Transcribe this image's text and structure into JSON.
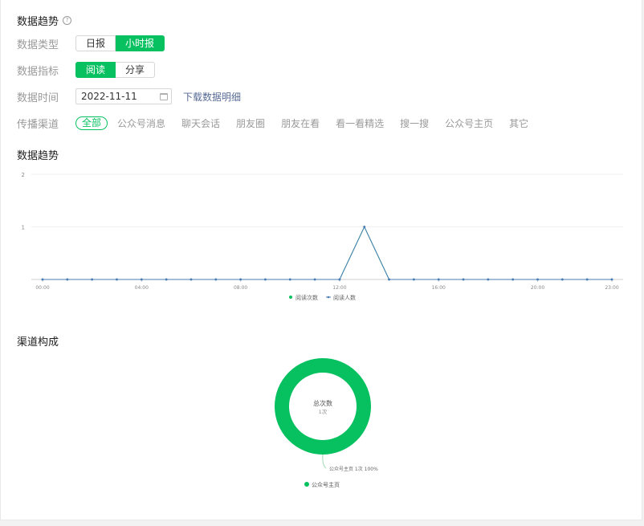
{
  "header": {
    "title": "数据趋势",
    "help_icon": "question-circle-icon"
  },
  "filters": {
    "data_type": {
      "label": "数据类型",
      "options": [
        "日报",
        "小时报"
      ],
      "selected": "小时报"
    },
    "metric": {
      "label": "数据指标",
      "options": [
        "阅读",
        "分享"
      ],
      "selected": "阅读"
    },
    "date": {
      "label": "数据时间",
      "value": "2022-11-11",
      "icon": "calendar-icon"
    },
    "download_label": "下载数据明细",
    "channel": {
      "label": "传播渠道",
      "options": [
        "全部",
        "公众号消息",
        "聊天会话",
        "朋友圈",
        "朋友在看",
        "看一看精选",
        "搜一搜",
        "公众号主页",
        "其它"
      ],
      "selected": "全部"
    }
  },
  "trend_section": {
    "title": "数据趋势"
  },
  "composition_section": {
    "title": "渠道构成"
  },
  "colors": {
    "accent": "#07c160",
    "link": "#576b95",
    "line": "#4a7db3"
  },
  "chart_data": [
    {
      "type": "line",
      "x": [
        "00:00",
        "01:00",
        "02:00",
        "03:00",
        "04:00",
        "05:00",
        "06:00",
        "07:00",
        "08:00",
        "09:00",
        "10:00",
        "11:00",
        "12:00",
        "13:00",
        "14:00",
        "15:00",
        "16:00",
        "17:00",
        "18:00",
        "19:00",
        "20:00",
        "21:00",
        "22:00",
        "23:00"
      ],
      "xticks": [
        "00:00",
        "04:00",
        "08:00",
        "12:00",
        "16:00",
        "20:00",
        "23:00"
      ],
      "yticks": [
        "1",
        "2"
      ],
      "ylim": [
        0,
        2
      ],
      "series": [
        {
          "name": "阅读次数",
          "values": [
            0,
            0,
            0,
            0,
            0,
            0,
            0,
            0,
            0,
            0,
            0,
            0,
            0,
            1,
            0,
            0,
            0,
            0,
            0,
            0,
            0,
            0,
            0,
            0
          ]
        },
        {
          "name": "阅读人数",
          "values": [
            0,
            0,
            0,
            0,
            0,
            0,
            0,
            0,
            0,
            0,
            0,
            0,
            0,
            1,
            0,
            0,
            0,
            0,
            0,
            0,
            0,
            0,
            0,
            0
          ]
        }
      ],
      "legend_position": "bottom",
      "grid": true
    },
    {
      "type": "pie",
      "center_title": "总次数",
      "center_value": "1次",
      "slices": [
        {
          "name": "公众号主页",
          "value": 1,
          "percent": "100%",
          "label": "公众号主页 1次 100%"
        }
      ],
      "legend_position": "bottom"
    }
  ]
}
